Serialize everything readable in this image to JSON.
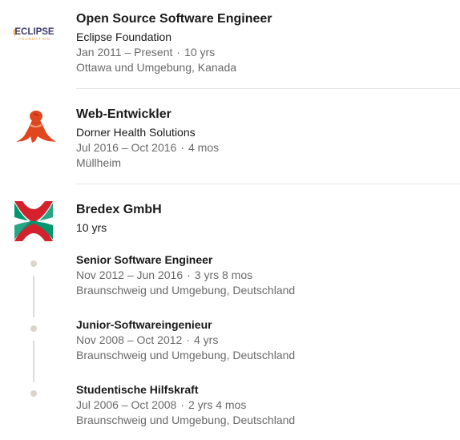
{
  "experiences": [
    {
      "title": "Open Source Software Engineer",
      "company": "Eclipse Foundation",
      "dates": "Jan 2011 – Present",
      "duration": "10 yrs",
      "location": "Ottawa und Umgebung, Kanada",
      "logo_text": "ECLIPSE",
      "logo_subtext": "FOUNDATION"
    },
    {
      "title": "Web-Entwickler",
      "company": "Dorner Health Solutions",
      "dates": "Jul 2016 – Oct 2016",
      "duration": "4 mos",
      "location": "Müllheim"
    },
    {
      "company": "Bredex GmbH",
      "total_duration": "10 yrs",
      "roles": [
        {
          "title": "Senior Software Engineer",
          "dates": "Nov 2012 – Jun 2016",
          "duration": "3 yrs 8 mos",
          "location": "Braunschweig und Umgebung, Deutschland"
        },
        {
          "title": "Junior-Softwareingenieur",
          "dates": "Nov 2008 – Oct 2012",
          "duration": "4 yrs",
          "location": "Braunschweig und Umgebung, Deutschland"
        },
        {
          "title": "Studentische Hilfskraft",
          "dates": "Jul 2006 – Oct 2008",
          "duration": "2 yrs 4 mos",
          "location": "Braunschweig und Umgebung, Deutschland"
        }
      ]
    }
  ],
  "separator": "·",
  "colors": {
    "eclipse_orange": "#f7941e",
    "dorner_red": "#e0471f",
    "bredex_green": "#00966e",
    "bredex_red": "#d4222c"
  }
}
